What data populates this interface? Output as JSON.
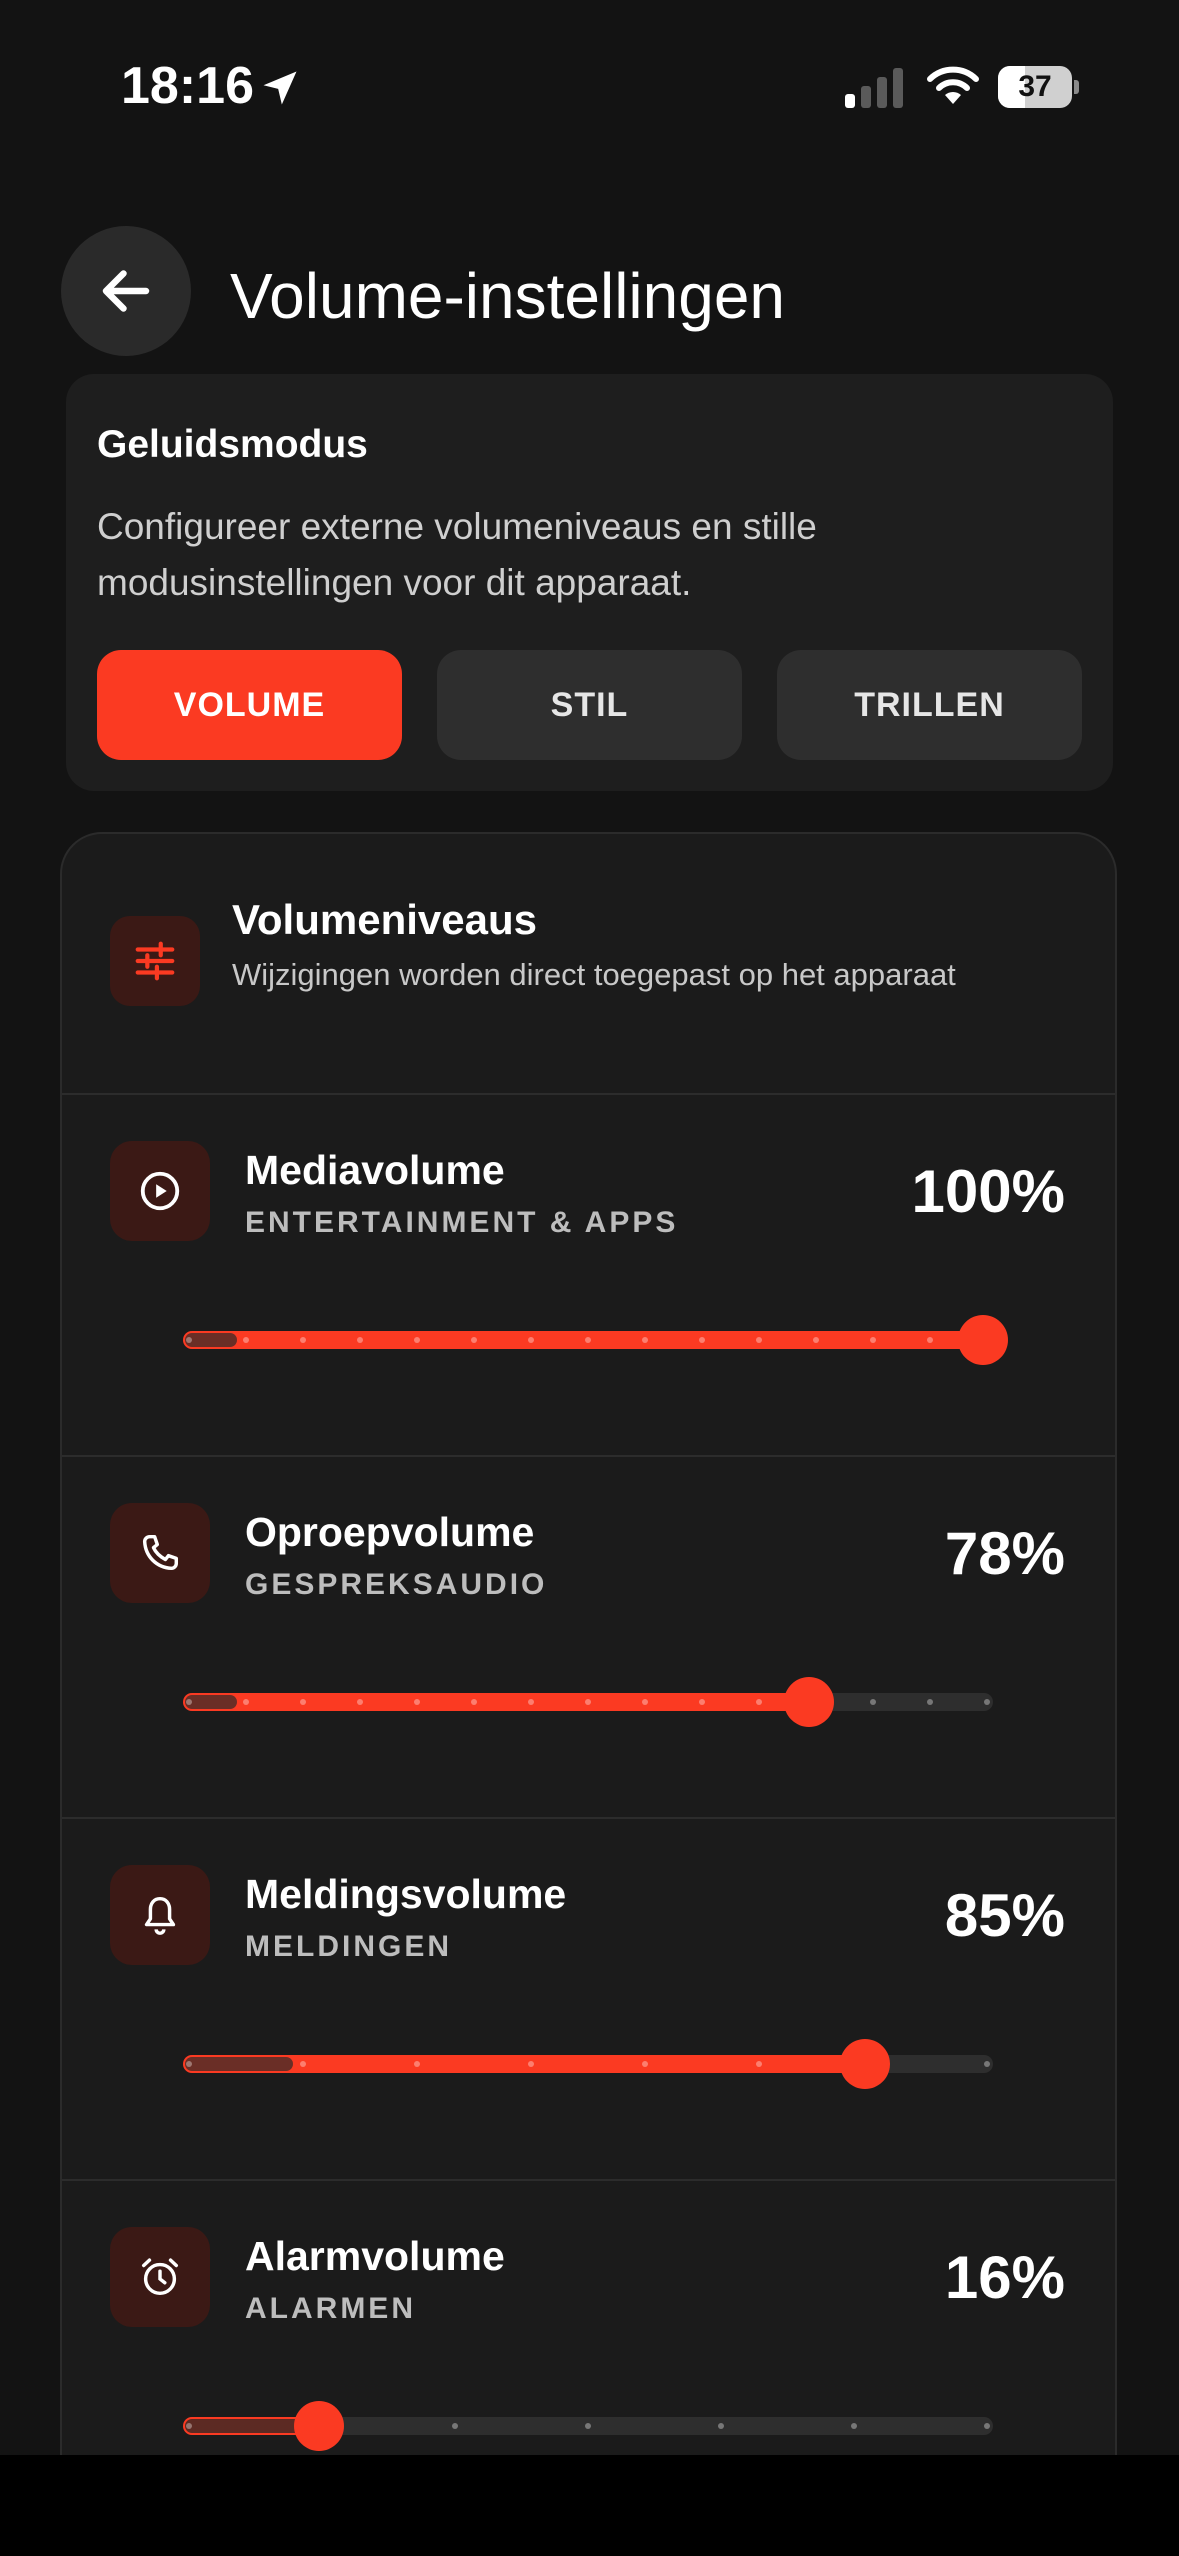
{
  "status": {
    "time": "18:16",
    "battery": "37",
    "battery_level": 0.37
  },
  "header": {
    "title": "Volume-instellingen"
  },
  "mode": {
    "title": "Geluidsmodus",
    "description": "Configureer externe volumeniveaus en stille modusinstellingen voor dit apparaat.",
    "buttons": [
      "VOLUME",
      "STIL",
      "TRILLEN"
    ],
    "selected": "VOLUME"
  },
  "levels": {
    "title": "Volumeniveaus",
    "subtitle": "Wijzigingen worden direct toegepast op het apparaat",
    "items": [
      {
        "title": "Mediavolume",
        "subtitle": "ENTERTAINMENT & APPS",
        "percent_label": "100%",
        "value": 100,
        "ticks": 15,
        "icon": "play-circle-icon"
      },
      {
        "title": "Oproepvolume",
        "subtitle": "GESPREKSAUDIO",
        "percent_label": "78%",
        "value": 78,
        "ticks": 15,
        "icon": "phone-icon"
      },
      {
        "title": "Meldingsvolume",
        "subtitle": "MELDINGEN",
        "percent_label": "85%",
        "value": 85,
        "ticks": 8,
        "icon": "bell-icon"
      },
      {
        "title": "Alarmvolume",
        "subtitle": "ALARMEN",
        "percent_label": "16%",
        "value": 16,
        "ticks": 7,
        "icon": "alarm-clock-icon"
      }
    ]
  },
  "colors": {
    "accent": "#fb3a22",
    "background": "#131313",
    "card": "#1e1e1e"
  }
}
